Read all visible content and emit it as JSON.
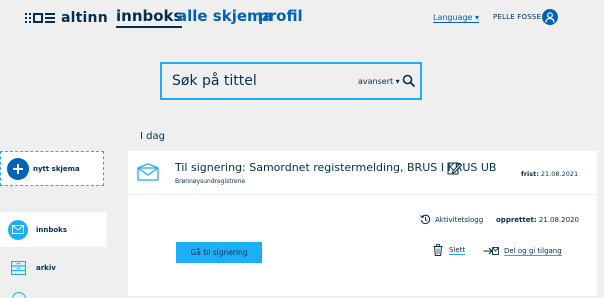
{
  "header": {
    "brand": "altinn",
    "nav": [
      {
        "label": "innboks",
        "active": true
      },
      {
        "label": "alle skjema",
        "active": false
      },
      {
        "label": "profil",
        "active": false
      }
    ],
    "language_label": "Language",
    "user_name": "PELLE FOSSE"
  },
  "search": {
    "placeholder": "Søk på tittel",
    "advanced_label": "avansert"
  },
  "sidebar": {
    "new_form_label": "nytt skjema",
    "items": [
      {
        "label": "innboks",
        "icon": "envelope-icon",
        "active": true
      },
      {
        "label": "arkiv",
        "icon": "archive-icon",
        "active": false
      }
    ]
  },
  "inbox": {
    "day_heading": "I dag",
    "item": {
      "title": "Til signering: Samordnet registermelding, BRUS I KRUS UB",
      "sender": "Brønnøysundregistrene",
      "deadline_label": "frist:",
      "deadline_value": "21.08.2021",
      "activity_log_label": "Aktivitetslogg",
      "created_label": "opprettet:",
      "created_value": "21.08.2020",
      "sign_button": "Gå til signering",
      "delete_label": "Slett",
      "share_label": "Del og gi tilgang"
    }
  },
  "colors": {
    "primary": "#0062ba",
    "accent": "#1eaef7",
    "dark": "#022f51",
    "background": "#efefef"
  }
}
